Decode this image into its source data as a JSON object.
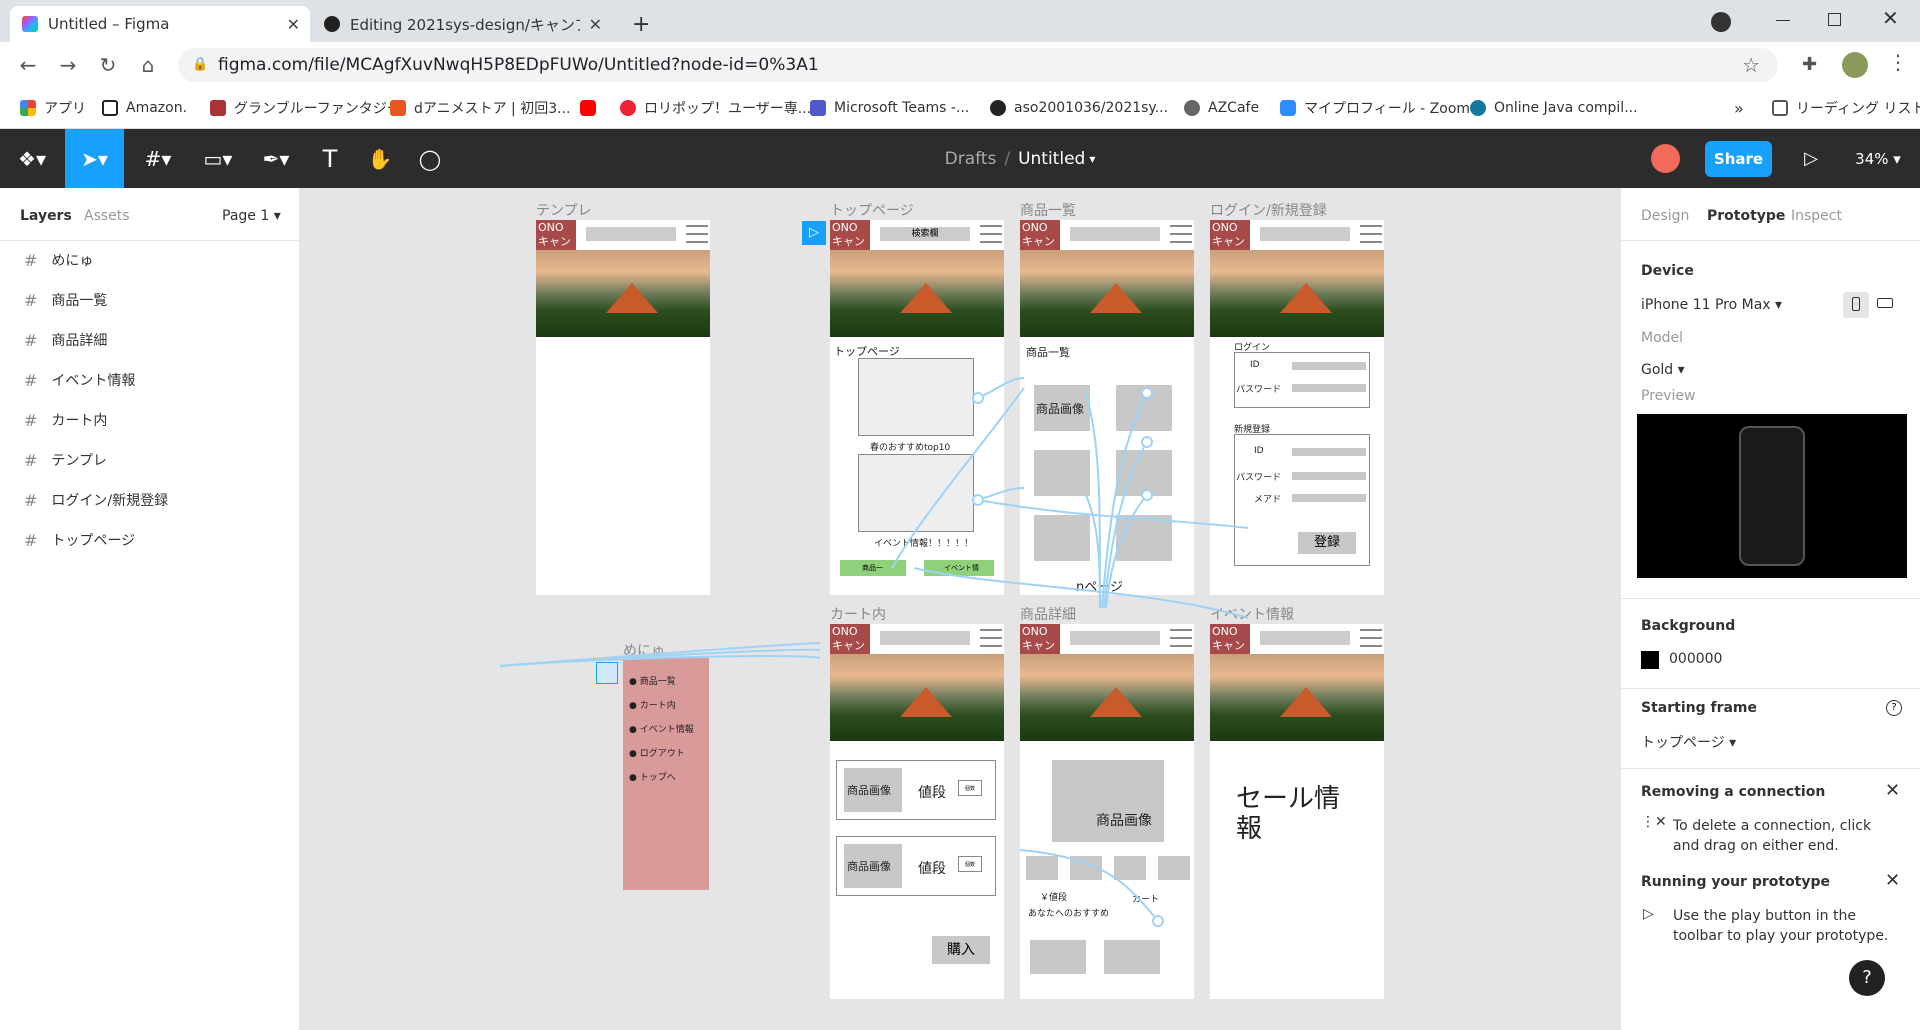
{
  "browser": {
    "tabs": [
      {
        "title": "Untitled – Figma",
        "close": "✕"
      },
      {
        "title": "Editing 2021sys-design/キャンプ.m",
        "close": "✕"
      }
    ],
    "new_tab": "+",
    "url": "figma.com/file/MCAgfXuvNwqH5P8EDpFUWo/Untitled?node-id=0%3A1",
    "bookmarks": [
      "アプリ",
      "Amazon.",
      "グランブルーファンタジー",
      "dアニメストア | 初回3...",
      "ロリポップ！ユーザー専...",
      "Microsoft Teams -...",
      "aso2001036/2021sy...",
      "AZCafe",
      "マイプロフィール - Zoom",
      "Online Java compil..."
    ],
    "bookmarks_more": "»",
    "reading_list": "リーディング リスト"
  },
  "figma": {
    "breadcrumb_drafts": "Drafts",
    "breadcrumb_sep": "/",
    "file_name": "Untitled",
    "share": "Share",
    "zoom": "34%",
    "left_tabs": {
      "layers": "Layers",
      "assets": "Assets",
      "page": "Page 1"
    },
    "layers": [
      "めにゅ",
      "商品一覧",
      "商品詳細",
      "イベント情報",
      "カート内",
      "テンプレ",
      "ログイン/新規登録",
      "トップページ"
    ],
    "right_tabs": {
      "design": "Design",
      "prototype": "Prototype",
      "inspect": "Inspect"
    },
    "device_label": "Device",
    "device_value": "iPhone 11 Pro Max",
    "model_label": "Model",
    "model_value": "Gold",
    "preview_label": "Preview",
    "background_label": "Background",
    "background_value": "000000",
    "starting_frame_label": "Starting frame",
    "starting_frame_value": "トップページ",
    "removing_title": "Removing a connection",
    "removing_text": "To delete a connection, click and drag on either end.",
    "running_title": "Running your prototype",
    "running_text": "Use the play button in the toolbar to play your prototype.",
    "help": "?"
  },
  "canvas": {
    "frames": {
      "template": "テンプレ",
      "top": "トップページ",
      "list": "商品一覧",
      "login": "ログイン/新規登録",
      "cart": "カート内",
      "detail": "商品詳細",
      "event": "イベント情報",
      "menu": "めにゅ"
    },
    "logo": "ONO\nキャン",
    "search": "検索欄",
    "top_heading": "トップページ",
    "top_caption1": "春のおすすめtop10",
    "top_caption2": "イベント情報！！！！！",
    "top_btn1": "商品一",
    "top_btn2": "イベント情",
    "list_heading": "商品一覧",
    "product_image": "商品画像",
    "page_n": "nページ",
    "login_heading": "ログイン",
    "id": "ID",
    "password": "パスワード",
    "register_heading": "新規登録",
    "mail": "メアド",
    "register_btn": "登録",
    "price": "値段",
    "buy": "購入",
    "qty": "個数",
    "detail_price": "￥値段",
    "detail_cart": "カート",
    "recommend": "あなたへのおすすめ",
    "sale": "セール情報",
    "menu_items": [
      "商品一覧",
      "カート内",
      "イベント情報",
      "ログアウト",
      "トップへ"
    ]
  },
  "colors": {
    "figma_blue": "#18a0fb",
    "share_bg": "#18a0fb",
    "logo_red": "#a84a4a",
    "menu_pink": "#d99a9a",
    "connector": "#9fd3f5"
  }
}
